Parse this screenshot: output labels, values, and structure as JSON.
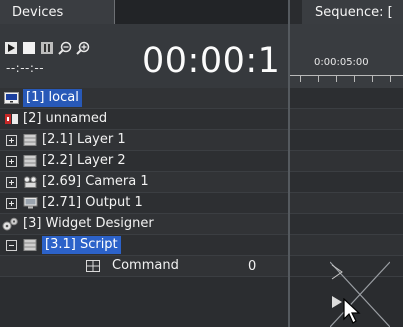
{
  "devices": {
    "tab_label": "Devices",
    "timecode": "00:00:1",
    "timecode_small": "--:--:--",
    "toolbar": {
      "play": "play-icon",
      "stop": "stop-icon",
      "pause": "pause-icon",
      "zoom_out": "zoom-out-icon",
      "zoom_in": "zoom-in-icon"
    },
    "rows": [
      {
        "label": "[1] local",
        "icon": "local-device-icon",
        "selected_style": "local"
      },
      {
        "label": "[2] unnamed",
        "icon": "device-icon"
      },
      {
        "label": "[2.1] Layer 1",
        "icon": "layer-icon",
        "expander": "plus"
      },
      {
        "label": "[2.2] Layer 2",
        "icon": "layer-icon",
        "expander": "plus"
      },
      {
        "label": "[2.69] Camera 1",
        "icon": "camera-icon",
        "expander": "plus"
      },
      {
        "label": "[2.71] Output 1",
        "icon": "monitor-icon",
        "expander": "plus"
      },
      {
        "label": "[3] Widget Designer",
        "icon": "gears-icon"
      },
      {
        "label": "[3.1] Script",
        "icon": "layer-icon",
        "expander": "minus",
        "selected": true
      },
      {
        "label": "Command",
        "value": "0",
        "icon": "command-icon"
      }
    ]
  },
  "sequence": {
    "tab_label": "Sequence: [",
    "ruler_time": "0:00:05:00"
  },
  "colors": {
    "selection": "#2c62c9",
    "background": "#2b2d30"
  }
}
